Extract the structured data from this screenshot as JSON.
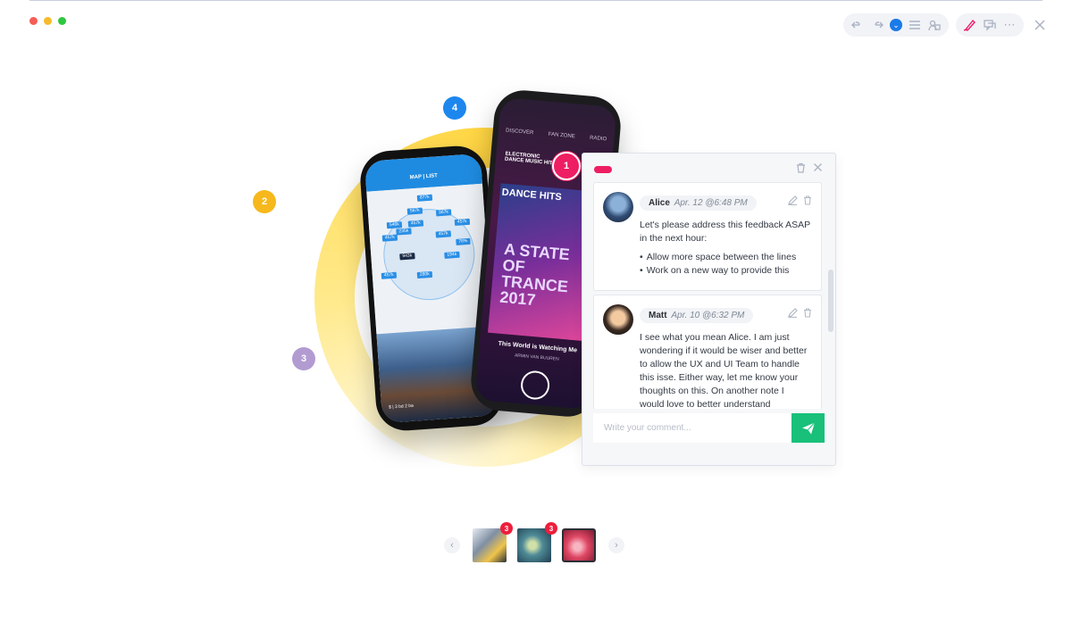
{
  "window": {
    "traffic_lights": [
      "close",
      "minimize",
      "maximize"
    ]
  },
  "toolbar": {
    "icons": [
      "undo-icon",
      "redo-icon",
      "chevron-down-icon",
      "menu-icon",
      "contributors-icon",
      "pen-icon",
      "comments-icon",
      "more-icon",
      "close-icon"
    ]
  },
  "stage": {
    "markers": [
      {
        "number": "1",
        "color": "#ee1e63"
      },
      {
        "number": "2",
        "color": "#f6b81c"
      },
      {
        "number": "3",
        "color": "#b29bd1"
      },
      {
        "number": "4",
        "color": "#1d87ee"
      }
    ],
    "left_phone": {
      "tabs": "MAP | LIST",
      "pins": [
        "877k",
        "567k",
        "546k",
        "457k",
        "235k",
        "367k",
        "457k",
        "457k",
        "457k",
        "943k",
        "194k",
        "457k",
        "280k",
        "78%"
      ],
      "house_caption": "$ | 3 bd 2 ba"
    },
    "right_phone": {
      "nav": [
        "DISCOVER",
        "FAN ZONE",
        "RADIO"
      ],
      "station": "ELECTRONIC DANCE MUSIC HITS",
      "art_title": "DANCE HITS",
      "art_big": "A STATE OF TRANCE 2017",
      "song": "This World is Watching Me",
      "artist": "ARMIN VAN BUUREN"
    }
  },
  "panel": {
    "accent": "#ee1e63",
    "comments": [
      {
        "author": "Alice",
        "date": "Apr. 12 @6:48 PM",
        "text": "Let's please address this feedback ASAP in the next hour:",
        "bullets": [
          "Allow more space between the lines",
          "Work on a new way to provide this"
        ]
      },
      {
        "author": "Matt",
        "date": "Apr. 10 @6:32 PM",
        "text": "I see what you mean Alice. I am just wondering if it would be wiser and better to allow the UX and UI Team to handle this isse. Either way, let me know your thoughts on this. On another note I would love to better understand"
      }
    ],
    "composer_placeholder": "Write your comment...",
    "send_color": "#18c07a"
  },
  "thumbnails": [
    {
      "badge": "3"
    },
    {
      "badge": "3"
    },
    {
      "badge": ""
    }
  ]
}
